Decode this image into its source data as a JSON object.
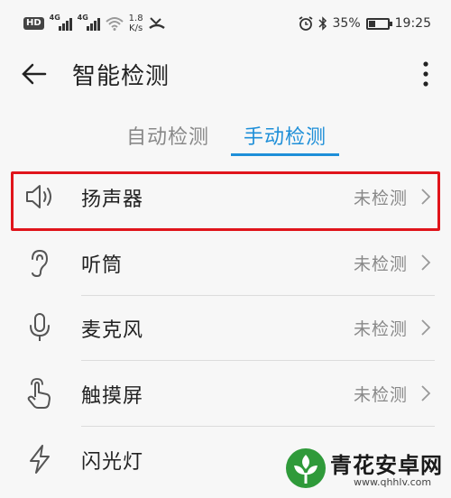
{
  "status_bar": {
    "hd": "HD",
    "net1": "4G",
    "net2": "4G",
    "speed_value": "1.8",
    "speed_unit": "K/s",
    "battery_text": "35%",
    "battery_level": 0.35,
    "time": "19:25"
  },
  "header": {
    "title": "智能检测"
  },
  "tabs": [
    {
      "label": "自动检测",
      "active": false
    },
    {
      "label": "手动检测",
      "active": true
    }
  ],
  "items": [
    {
      "label": "扬声器",
      "status": "未检测",
      "icon": "speaker-icon",
      "highlighted": true
    },
    {
      "label": "听筒",
      "status": "未检测",
      "icon": "ear-icon"
    },
    {
      "label": "麦克风",
      "status": "未检测",
      "icon": "microphone-icon"
    },
    {
      "label": "触摸屏",
      "status": "未检测",
      "icon": "touch-hand-icon"
    },
    {
      "label": "闪光灯",
      "status": "",
      "icon": "lightning-icon"
    }
  ],
  "watermark": {
    "title": "青花安卓网",
    "url": "www.qhhlv.com"
  },
  "colors": {
    "accent": "#1e8fd8",
    "highlight": "#e0141b",
    "text_secondary": "#888888"
  }
}
